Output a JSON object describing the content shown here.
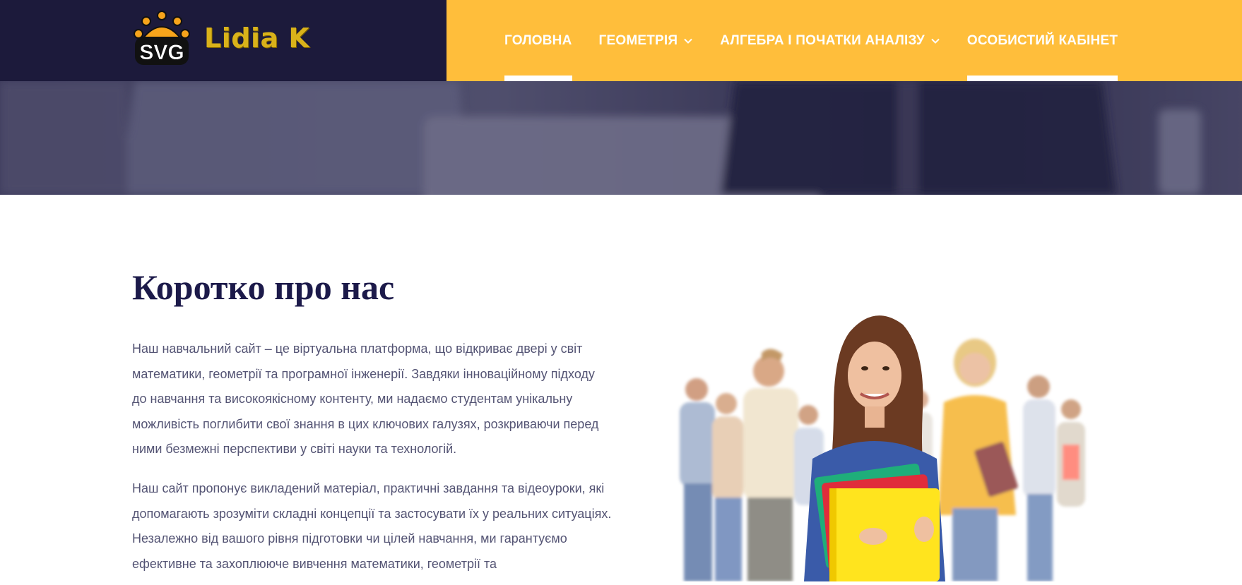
{
  "brand": {
    "logo_badge_text": "SVG",
    "name": "Lidia K"
  },
  "nav": {
    "items": [
      {
        "label": "Головна",
        "active": true,
        "has_dropdown": false
      },
      {
        "label": "Геометрія",
        "active": false,
        "has_dropdown": true
      },
      {
        "label": "Алгебра і початки аналізу",
        "active": false,
        "has_dropdown": true
      },
      {
        "label": "Особистий кабінет",
        "active": false,
        "has_dropdown": false,
        "underlined": true
      }
    ]
  },
  "about": {
    "title": "Коротко про нас",
    "paragraphs": [
      "Наш навчальний сайт – це віртуальна платформа, що відкриває двері у світ математики, геометрії та програмної інженерії. Завдяки інноваційному підходу до навчання та високоякісному контенту, ми надаємо студентам унікальну можливість поглибити свої знання в цих ключових галузях, розкриваючи перед ними безмежні перспективи у світі науки та технологій.",
      "Наш сайт пропонує викладений матеріал, практичні завдання та відеоуроки, які допомагають зрозуміти складні концепції та застосувати їх у реальних ситуаціях. Незалежно від вашого рівня підготовки чи цілей навчання, ми гарантуємо ефективне та захоплююче вивчення математики, геометрії та"
    ]
  },
  "colors": {
    "header_dark": "#1c1a3b",
    "header_accent": "#ffbe3b",
    "title": "#1c1a4a",
    "body_text": "#545474",
    "brand_gold": "#d9b21a"
  },
  "icons": {
    "logo": "svg-crown-badge-icon",
    "dropdown": "chevron-down-icon"
  }
}
